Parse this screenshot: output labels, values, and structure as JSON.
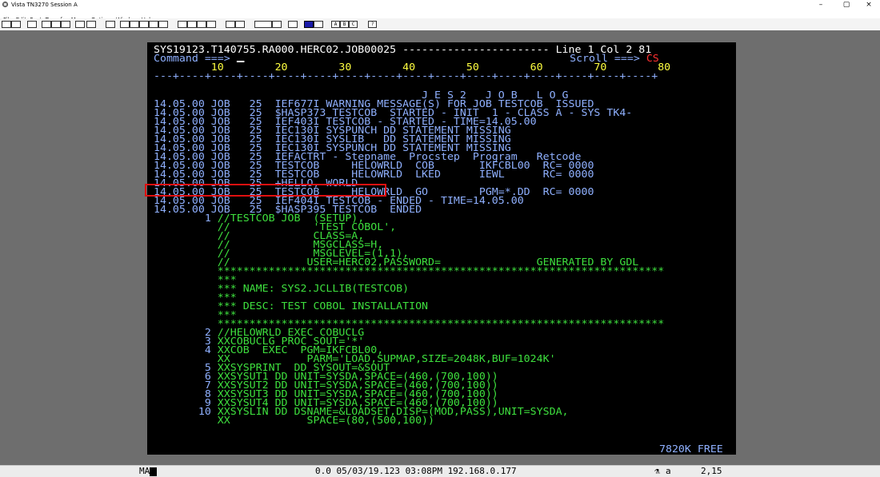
{
  "window": {
    "title": "Vista TN3270 Session A",
    "minimize": "–",
    "maximize": "▢",
    "close": "×"
  },
  "menu": [
    {
      "label": "File",
      "u": "F",
      "rest": "ile"
    },
    {
      "label": "Edit",
      "u": "E",
      "rest": "dit"
    },
    {
      "label": "Font",
      "u": "Fo",
      "rest": "nt"
    },
    {
      "label": "Transfer",
      "u": "T",
      "rest": "ransfer"
    },
    {
      "label": "Macro",
      "u": "M",
      "rest": "acro"
    },
    {
      "label": "Options",
      "u": "O",
      "rest": "ptions"
    },
    {
      "label": "Window",
      "u": "W",
      "rest": "indow"
    },
    {
      "label": "Help",
      "u": "H",
      "rest": "elp"
    }
  ],
  "toolbar": {
    "letter_buttons": [
      "A",
      "B",
      "C"
    ],
    "help_button": "?"
  },
  "screen": {
    "header_dsn": "SYS19123.T140755.RA000.HERC02.JOB00025 ",
    "header_dashes": "-----------------------",
    "header_linecol": " Line 1 Col 2 81",
    "command_label": "Command ===> ",
    "scroll_label": "Scroll ===> ",
    "scroll_value": "CS",
    "ruler_numbers": "         10        20        30        40        50        60        70        80",
    "ruler_marks": "---+----+----+----+----+----+----+----+----+----+----+----+----+----+----+----+",
    "banner": "                                          J E S 2   J O B   L O G",
    "log_lines": [
      "14.05.00 JOB   25  IEF677I WARNING MESSAGE(S) FOR JOB TESTCOB  ISSUED",
      "14.05.00 JOB   25  $HASP373 TESTCOB  STARTED - INIT  1 - CLASS A - SYS TK4-",
      "14.05.00 JOB   25  IEF403I TESTCOB - STARTED - TIME=14.05.00",
      "14.05.00 JOB   25  IEC130I SYSPUNCH DD STATEMENT MISSING",
      "14.05.00 JOB   25  IEC130I SYSLIB   DD STATEMENT MISSING",
      "14.05.00 JOB   25  IEC130I SYSPUNCH DD STATEMENT MISSING",
      "14.05.00 JOB   25  IEFACTRT - Stepname  Procstep  Program   Retcode",
      "14.05.00 JOB   25  TESTCOB     HELOWRLD  COB       IKFCBL00  RC= 0000",
      "14.05.00 JOB   25  TESTCOB     HELOWRLD  LKED      IEWL      RC= 0000",
      "14.05.00 JOB   25  +HELLO, WORLD",
      "14.05.00 JOB   25  TESTCOB     HELOWRLD  GO        PGM=*.DD  RC= 0000",
      "14.05.00 JOB   25  IEF404I TESTCOB - ENDED - TIME=14.05.00",
      "14.05.00 JOB   25  $HASP395 TESTCOB  ENDED"
    ],
    "jcl_lines": [
      {
        "num": "        1",
        "text": "//TESTCOB JOB  (SETUP),"
      },
      {
        "num": "",
        "text": "//             'TEST COBOL',"
      },
      {
        "num": "",
        "text": "//             CLASS=A,"
      },
      {
        "num": "",
        "text": "//             MSGCLASS=H,"
      },
      {
        "num": "",
        "text": "//             MSGLEVEL=(1,1),"
      },
      {
        "num": "",
        "text": "//            USER=HERC02,PASSWORD=               GENERATED BY GDL"
      },
      {
        "num": "",
        "text": "**********************************************************************"
      },
      {
        "num": "",
        "text": "***"
      },
      {
        "num": "",
        "text": "*** NAME: SYS2.JCLLIB(TESTCOB)"
      },
      {
        "num": "",
        "text": "***"
      },
      {
        "num": "",
        "text": "*** DESC: TEST COBOL INSTALLATION"
      },
      {
        "num": "",
        "text": "***"
      },
      {
        "num": "",
        "text": "**********************************************************************"
      },
      {
        "num": "        2",
        "text": "//HELOWRLD EXEC COBUCLG"
      },
      {
        "num": "        3",
        "text": "XXCOBUCLG PROC SOUT='*'"
      },
      {
        "num": "        4",
        "text": "XXCOB  EXEC  PGM=IKFCBL00,"
      },
      {
        "num": "",
        "text": "XX            PARM='LOAD,SUPMAP,SIZE=2048K,BUF=1024K'"
      },
      {
        "num": "        5",
        "text": "XXSYSPRINT  DD SYSOUT=&SOUT"
      },
      {
        "num": "        6",
        "text": "XXSYSUT1 DD UNIT=SYSDA,SPACE=(460,(700,100))"
      },
      {
        "num": "        7",
        "text": "XXSYSUT2 DD UNIT=SYSDA,SPACE=(460,(700,100))"
      },
      {
        "num": "        8",
        "text": "XXSYSUT3 DD UNIT=SYSDA,SPACE=(460,(700,100))"
      },
      {
        "num": "        9",
        "text": "XXSYSUT4 DD UNIT=SYSDA,SPACE=(460,(700,100))"
      },
      {
        "num": "       10",
        "text": "XXSYSLIN DD DSNAME=&LOADSET,DISP=(MOD,PASS),UNIT=SYSDA,"
      },
      {
        "num": "",
        "text": "XX            SPACE=(80,(500,100))"
      }
    ],
    "free_label": "7820K FREE"
  },
  "status": {
    "left": "MA",
    "center": "0.0 05/03/19.123 03:08PM 192.168.0.177",
    "lock": "a",
    "position": "2,15"
  },
  "colors": {
    "screen_bg": "#000000",
    "blue_text": "#8fb0ff",
    "green_text": "#3ee03e",
    "red_text": "#ff3030",
    "highlight_border": "#e01010",
    "workspace_bg": "#6e6e6e"
  }
}
